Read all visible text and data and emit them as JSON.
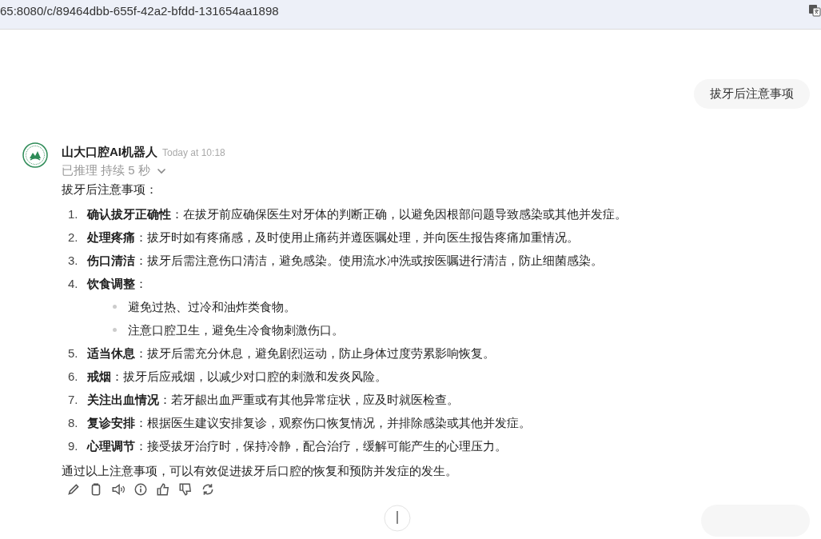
{
  "address_bar": {
    "url": "65:8080/c/89464dbb-655f-42a2-bfdd-131654aa1898"
  },
  "user_message": {
    "text": "拔牙后注意事项"
  },
  "assistant_message": {
    "name": "山大口腔AI机器人",
    "time": "Today at 10:18",
    "reasoning": {
      "text": "已推理 持续 5 秒",
      "expanded": false
    },
    "intro": "拔牙后注意事项：",
    "items": [
      {
        "number": "1.",
        "text": "**确认拔牙正确性**：在拔牙前应确保医生对牙体的判断正确，以避免因根部问题导致感染或其他并发症。"
      },
      {
        "number": "2.",
        "text": "**处理疼痛**：拔牙时如有疼痛感，及时使用止痛药并遵医嘱处理，并向医生报告疼痛加重情况。"
      },
      {
        "number": "3.",
        "text": "**伤口清洁**：拔牙后需注意伤口清洁，避免感染。使用流水冲洗或按医嘱进行清洁，防止细菌感染。"
      },
      {
        "number": "4.",
        "text": "**饮食调整**：",
        "children": [
          "避免过热、过冷和油炸类食物。",
          "注意口腔卫生，避免生冷食物刺激伤口。"
        ]
      },
      {
        "number": "5.",
        "text": "**适当休息**：拔牙后需充分休息，避免剧烈运动，防止身体过度劳累影响恢复。"
      },
      {
        "number": "6.",
        "text": "**戒烟**：拔牙后应戒烟，以减少对口腔的刺激和发炎风险。"
      },
      {
        "number": "7.",
        "text": "**关注出血情况**：若牙龈出血严重或有其他异常症状，应及时就医检查。"
      },
      {
        "number": "8.",
        "text": "**复诊安排**：根据医生建议安排复诊，观察伤口恢复情况，并排除感染或其他并发症。"
      },
      {
        "number": "9.",
        "text": "**心理调节**：接受拔牙治疗时，保持冷静，配合治疗，缓解可能产生的心理压力。"
      }
    ],
    "conclusion": "通过以上注意事项，可以有效促进拔牙后口腔的恢复和预防并发症的发生。",
    "actions": [
      {
        "kind": "edit"
      },
      {
        "kind": "copy"
      },
      {
        "kind": "speak"
      },
      {
        "kind": "info"
      },
      {
        "kind": "like"
      },
      {
        "kind": "dislike"
      },
      {
        "kind": "regenerate"
      }
    ]
  }
}
